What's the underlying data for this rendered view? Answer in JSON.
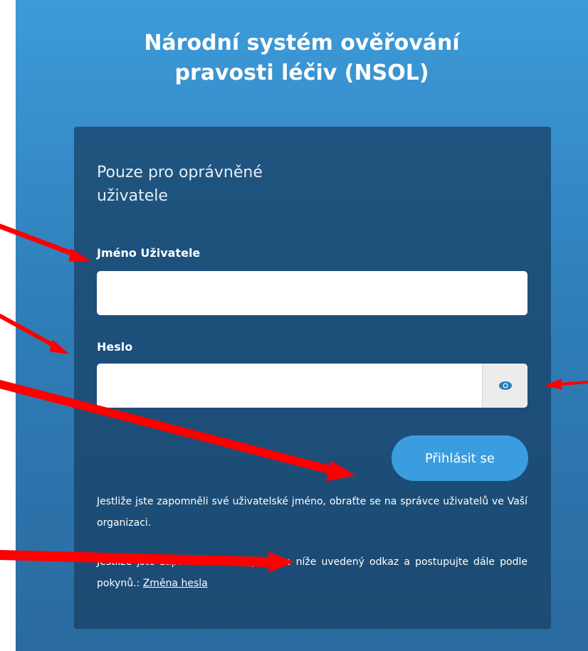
{
  "header": {
    "title_line1": "Národní systém ověřování",
    "title_line2": "pravosti léčiv (NSOL)"
  },
  "login": {
    "heading_line1": "Pouze pro oprávněné",
    "heading_line2": "uživatele",
    "username_label": "Jméno Uživatele",
    "username_value": "",
    "password_label": "Heslo",
    "password_value": "",
    "show_password_icon": "eye-icon",
    "submit_label": "Přihlásit se",
    "forgot_username_text": "Jestliže jste zapomněli své uživatelské jméno, obraťte se na správce uživatelů ve Vaší organizaci.",
    "forgot_password_text": "Jestliže jste zapomněli heslo, použijte níže uvedený odkaz a postupujte dále podle pokynů.:",
    "change_password_link": "Změna hesla"
  },
  "colors": {
    "background_top": "#3d9bd9",
    "background_bottom": "#2a6a9f",
    "card": "#163e62",
    "button": "#3a9ddf",
    "annotation_arrow": "#ff0000"
  }
}
